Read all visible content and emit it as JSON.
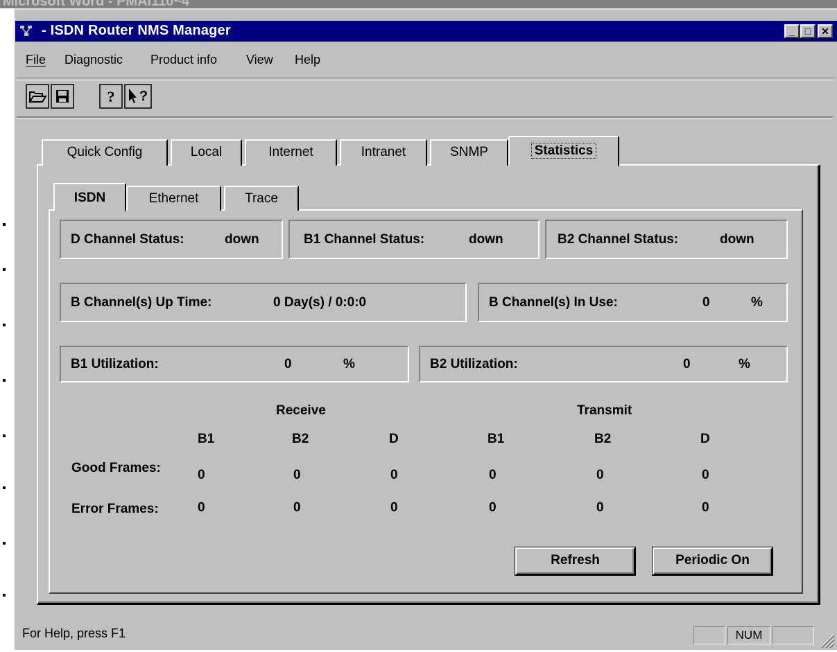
{
  "background_window": {
    "title": "Microsoft Word - PMAI110~4"
  },
  "window": {
    "title": "- ISDN Router NMS Manager",
    "controls": {
      "minimize": "_",
      "maximize": "□",
      "close": "✕"
    }
  },
  "menu": {
    "file": "File",
    "diagnostic": "Diagnostic",
    "product_info": "Product info",
    "view": "View",
    "help": "Help"
  },
  "toolbar": {
    "icons": [
      "open-folder-icon",
      "save-disk-icon",
      "help-icon",
      "context-help-icon"
    ]
  },
  "outer_tabs": [
    "Quick Config",
    "Local",
    "Internet",
    "Intranet",
    "SNMP",
    "Statistics"
  ],
  "outer_active_tab": "Statistics",
  "inner_tabs": [
    "ISDN",
    "Ethernet",
    "Trace"
  ],
  "inner_active_tab": "ISDN",
  "status": {
    "d_channel_label": "D Channel Status:",
    "d_channel_value": "down",
    "b1_channel_label": "B1 Channel Status:",
    "b1_channel_value": "down",
    "b2_channel_label": "B2 Channel Status:",
    "b2_channel_value": "down",
    "uptime_label": "B Channel(s)  Up Time:",
    "uptime_value": "0 Day(s) / 0:0:0",
    "in_use_label": "B Channel(s) In Use:",
    "in_use_value": "0",
    "in_use_unit": "%",
    "b1_util_label": "B1 Utilization:",
    "b1_util_value": "0",
    "b1_util_unit": "%",
    "b2_util_label": "B2 Utilization:",
    "b2_util_value": "0",
    "b2_util_unit": "%"
  },
  "frames": {
    "receive_label": "Receive",
    "transmit_label": "Transmit",
    "columns": [
      "B1",
      "B2",
      "D",
      "B1",
      "B2",
      "D"
    ],
    "rows": [
      {
        "label": "Good Frames:",
        "values": [
          "0",
          "0",
          "0",
          "0",
          "0",
          "0"
        ]
      },
      {
        "label": "Error Frames:",
        "values": [
          "0",
          "0",
          "0",
          "0",
          "0",
          "0"
        ]
      }
    ]
  },
  "buttons": {
    "refresh": "Refresh",
    "periodic": "Periodic On"
  },
  "statusbar": {
    "text": "For Help, press F1",
    "num": "NUM"
  }
}
